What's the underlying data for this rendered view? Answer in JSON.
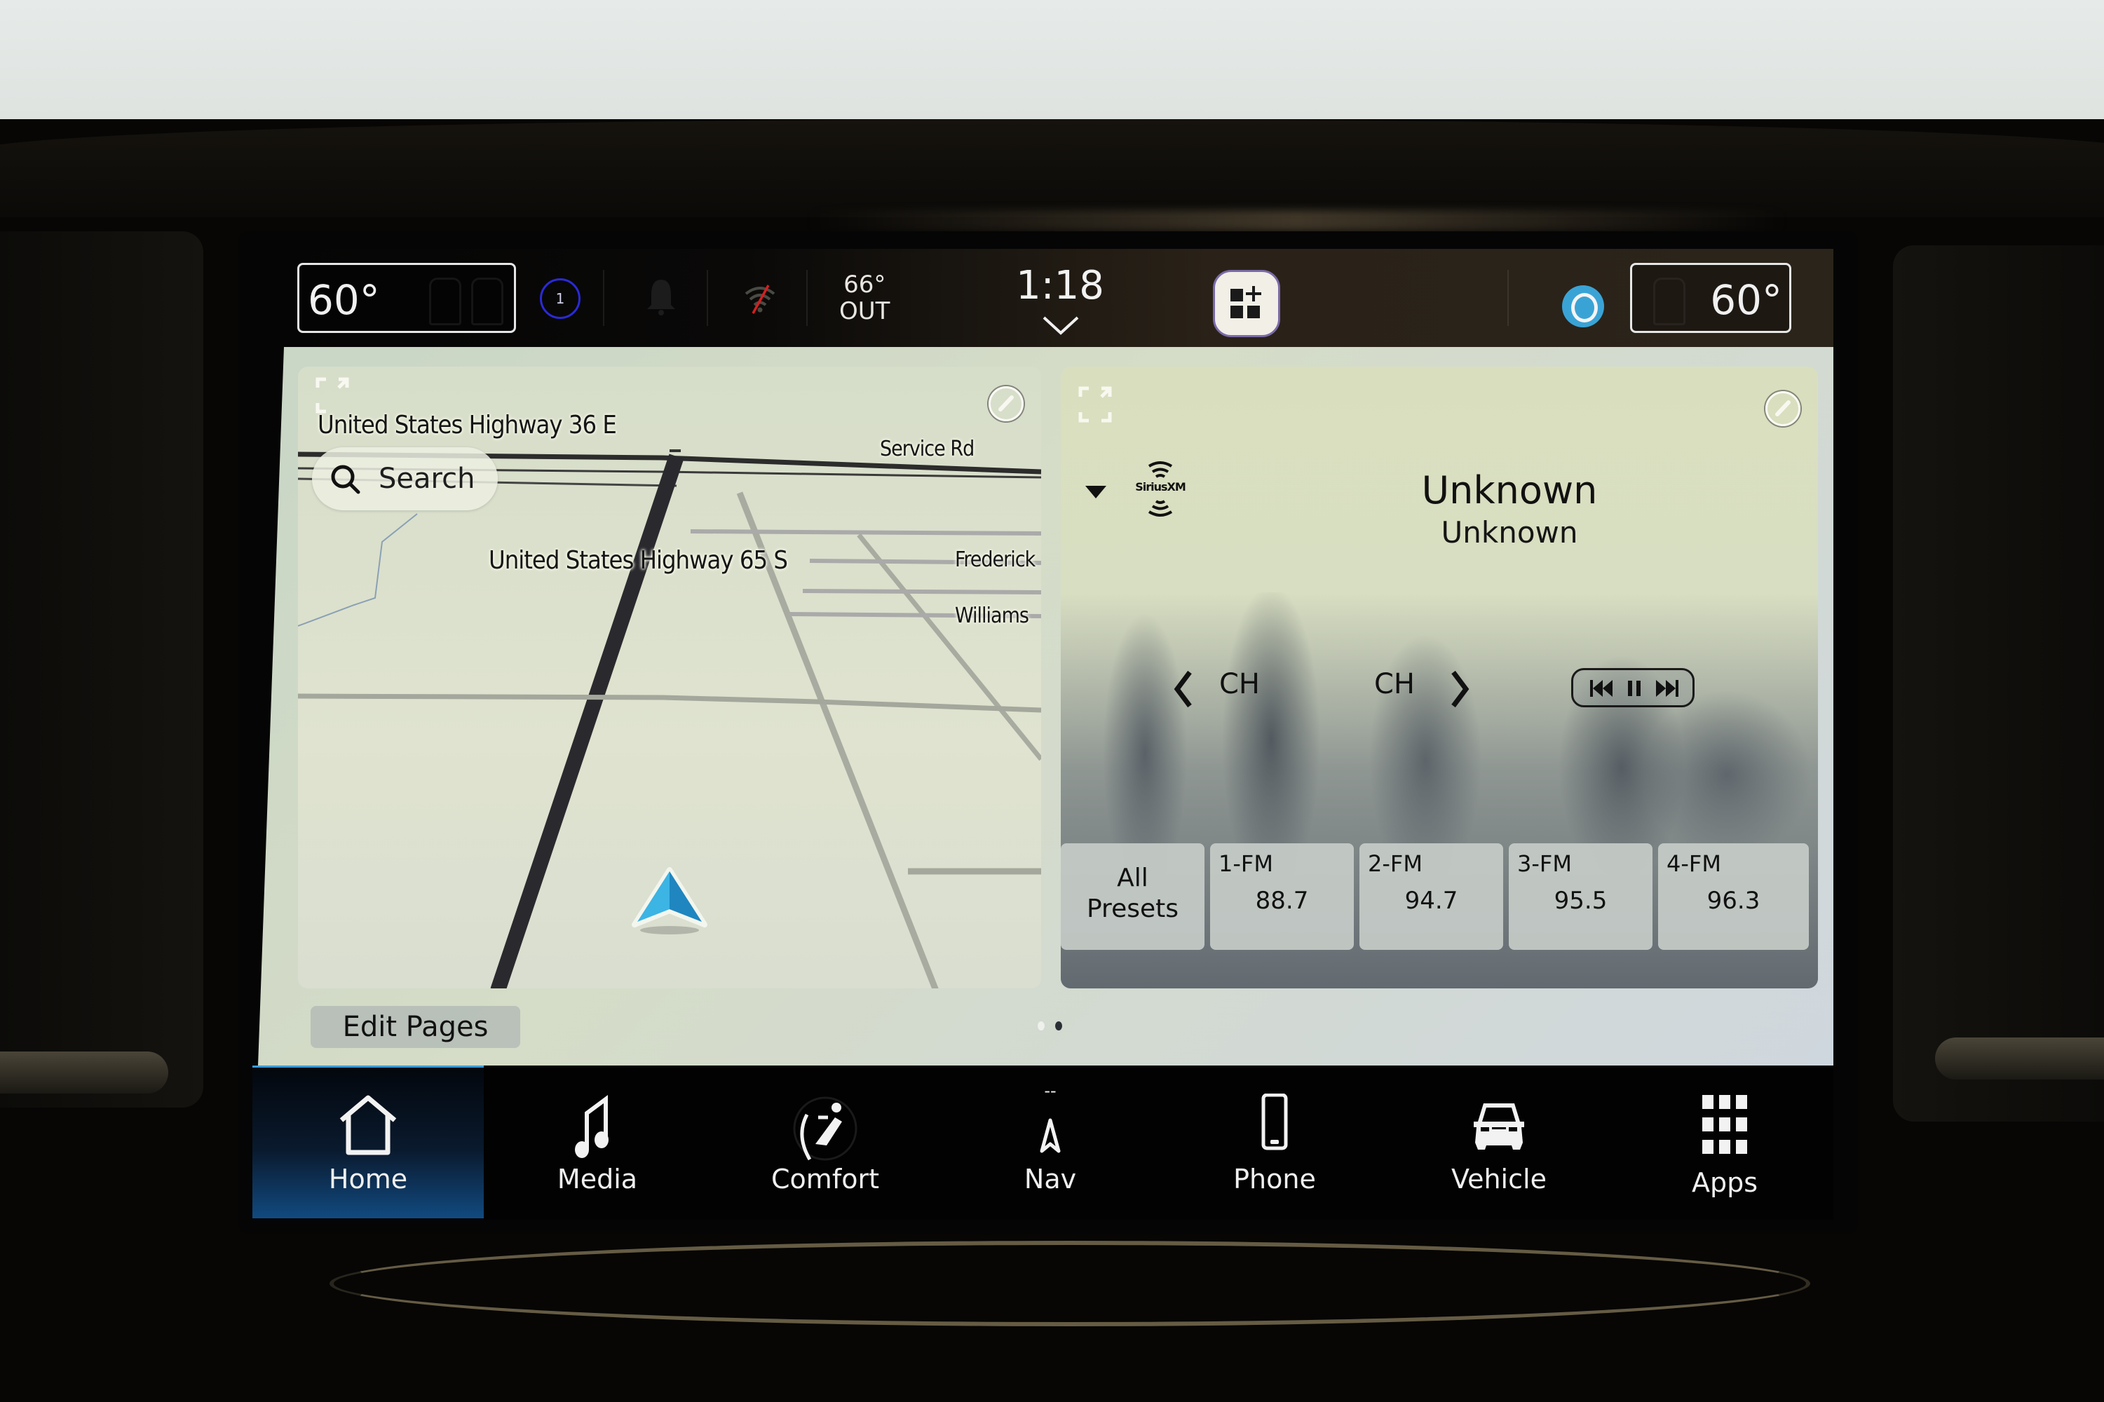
{
  "status_bar": {
    "driver_temp": "60°",
    "passenger_temp": "60°",
    "outside_temp": "66°",
    "outside_label": "OUT",
    "clock": "1:18",
    "driver_profile_number": "1",
    "icons": {
      "driver_profile": "driver-profile-icon",
      "notifications": "bell-icon",
      "wifi": "wifi-off-icon",
      "widget_add": "add-widget-icon",
      "voice_assistant": "alexa-icon",
      "clock_expand": "chevron-down-icon"
    },
    "colors": {
      "profile_ring": "#2a2ad8",
      "wifi_off_slash": "#d22020",
      "alexa": "#3aa3d6"
    }
  },
  "map_widget": {
    "search_label": "Search",
    "road_labels": [
      "United States Highway 36 E",
      "Service Rd",
      "United States Highway 65 S",
      "Frederick",
      "Williams"
    ],
    "icons": {
      "expand": "expand-icon",
      "edit": "pencil-icon",
      "search": "search-icon",
      "position": "navigation-arrow-icon"
    },
    "position_arrow_color": "#2a9ed4"
  },
  "radio_widget": {
    "source": "SiriusXM",
    "title": "Unknown",
    "subtitle": "Unknown",
    "ch_prev_label": "CH",
    "ch_next_label": "CH",
    "icons": {
      "expand": "expand-icon",
      "edit": "pencil-icon",
      "source_dropdown": "triangle-down-icon",
      "ch_prev": "chevron-left-icon",
      "ch_next": "chevron-right-icon",
      "transport": "prev-pause-next-icon"
    },
    "presets": {
      "all_label_line1": "All",
      "all_label_line2": "Presets",
      "items": [
        {
          "band": "1-FM",
          "freq": "88.7"
        },
        {
          "band": "2-FM",
          "freq": "94.7"
        },
        {
          "band": "3-FM",
          "freq": "95.5"
        },
        {
          "band": "4-FM",
          "freq": "96.3"
        }
      ]
    }
  },
  "home_page": {
    "edit_pages_label": "Edit Pages",
    "page_count": 2,
    "current_page": 2
  },
  "bottom_nav": {
    "active": "Home",
    "active_color": "#114a80",
    "items": [
      {
        "label": "Home",
        "icon": "home-icon"
      },
      {
        "label": "Media",
        "icon": "music-note-icon"
      },
      {
        "label": "Comfort",
        "icon": "seat-comfort-icon"
      },
      {
        "label": "Nav",
        "icon": "compass-arrow-icon",
        "indicator": "--"
      },
      {
        "label": "Phone",
        "icon": "phone-icon"
      },
      {
        "label": "Vehicle",
        "icon": "car-icon"
      },
      {
        "label": "Apps",
        "icon": "apps-grid-icon"
      }
    ]
  }
}
